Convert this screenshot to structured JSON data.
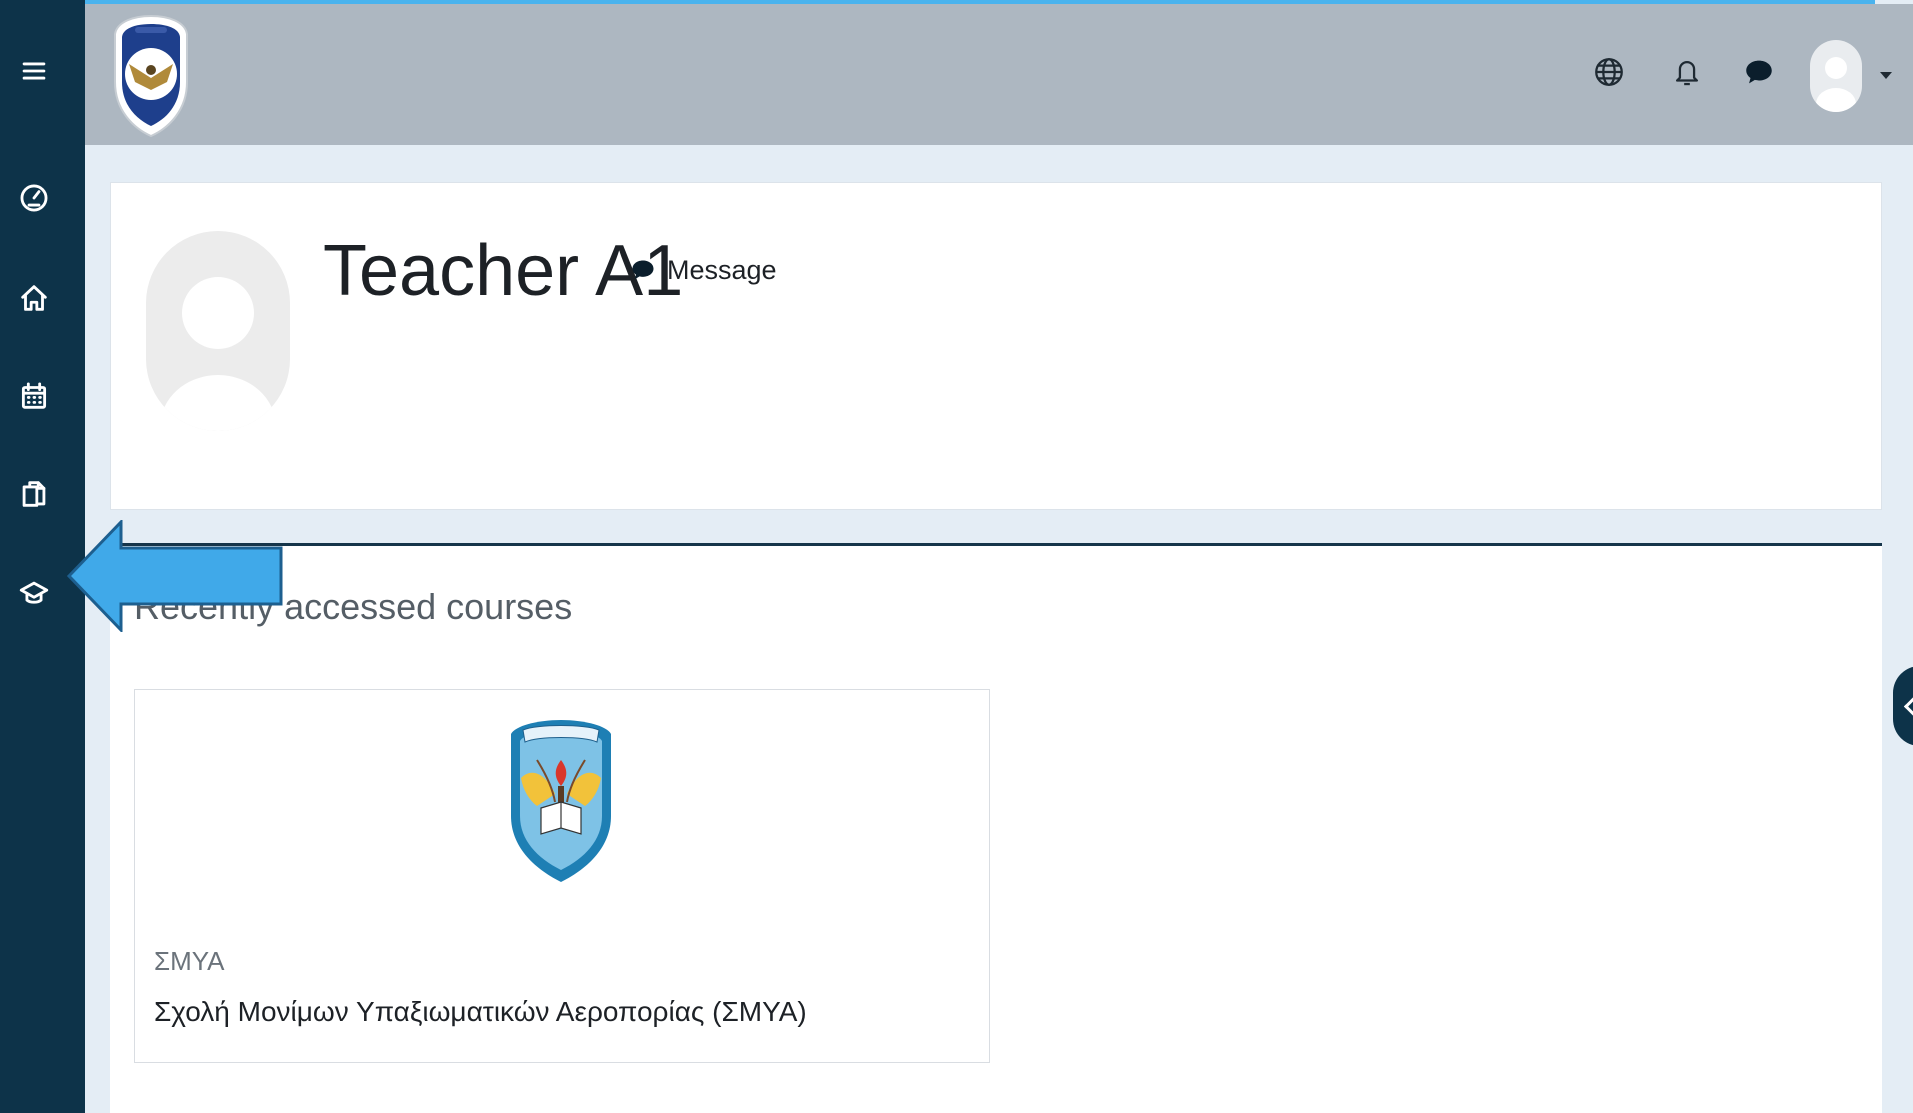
{
  "sidenav": {
    "items": [
      {
        "icon": "menu-icon"
      },
      {
        "icon": "dashboard-icon"
      },
      {
        "icon": "home-icon"
      },
      {
        "icon": "calendar-icon"
      },
      {
        "icon": "files-icon"
      },
      {
        "icon": "graduation-cap-icon"
      }
    ]
  },
  "header": {
    "logo": "site-crest-logo",
    "icons": [
      "globe-icon",
      "bell-icon",
      "chat-bubble-icon"
    ]
  },
  "profile": {
    "name": "Teacher A1",
    "message_label": "Message"
  },
  "courses": {
    "heading": "Recently accessed courses",
    "items": [
      {
        "short_name": "ΣΜΥΑ",
        "full_name": "Σχολή Μονίμων Υπαξιωματικών Αεροπορίας (ΣΜΥΑ)"
      }
    ]
  },
  "colors": {
    "sidebar": "#0d3349",
    "header": "#adb7c1",
    "page_bg": "#e4edf5",
    "accent_line": "#4ab3ee",
    "callout_arrow": "#40a9e9"
  }
}
